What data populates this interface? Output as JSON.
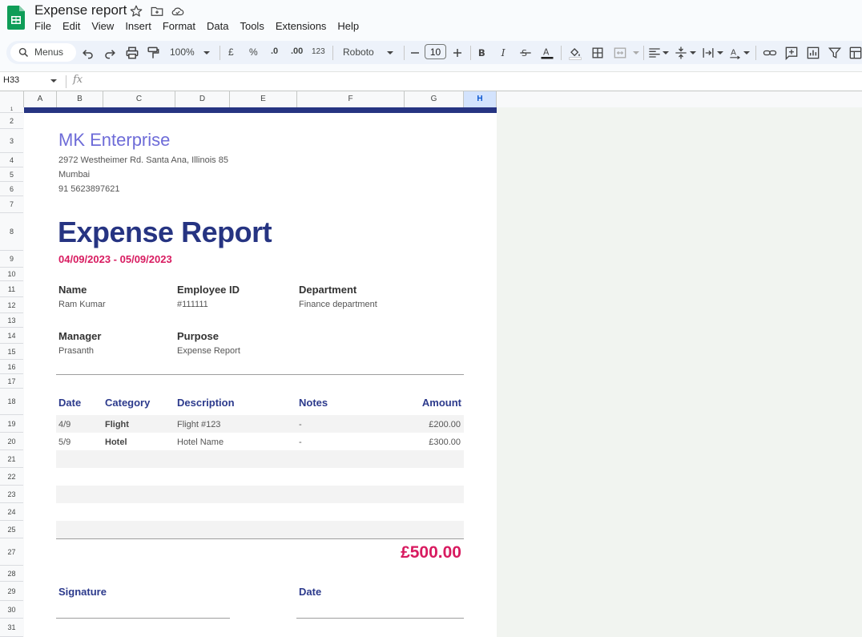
{
  "app": {
    "title": "Expense report",
    "menu": [
      "File",
      "Edit",
      "View",
      "Insert",
      "Format",
      "Data",
      "Tools",
      "Extensions",
      "Help"
    ]
  },
  "toolbar": {
    "search_label": "Menus",
    "zoom": "100%",
    "currency": "£",
    "percent": "%",
    "decrease_decimal": ".0",
    "increase_decimal": ".00",
    "number_format": "123",
    "font": "Roboto",
    "font_size": "10"
  },
  "formula_bar": {
    "cell_ref": "H33",
    "fx": "fx"
  },
  "columns": [
    "A",
    "B",
    "C",
    "D",
    "E",
    "F",
    "G",
    "H"
  ],
  "rows": [
    "1",
    "2",
    "3",
    "4",
    "5",
    "6",
    "7",
    "8",
    "9",
    "10",
    "11",
    "12",
    "13",
    "14",
    "15",
    "16",
    "17",
    "18",
    "19",
    "20",
    "21",
    "22",
    "23",
    "24",
    "25",
    "27",
    "28",
    "29",
    "30",
    "31"
  ],
  "colors": {
    "accent_blue": "#2c3a8c",
    "accent_pink": "#d81b60",
    "company": "#6e6cd8",
    "band": "#263482"
  },
  "sheet": {
    "company": "MK Enterprise",
    "address": "2972 Westheimer Rd. Santa Ana, Illinois 85",
    "city": "Mumbai",
    "phone": "91 5623897621",
    "heading": "Expense Report",
    "date_range": "04/09/2023 - 05/09/2023",
    "fields": {
      "name_label": "Name",
      "name": "Ram Kumar",
      "employee_id_label": "Employee ID",
      "employee_id": "#111111",
      "department_label": "Department",
      "department": "Finance department",
      "manager_label": "Manager",
      "manager": "Prasanth",
      "purpose_label": "Purpose",
      "purpose": "Expense  Report"
    },
    "table": {
      "headers": [
        "Date",
        "Category",
        "Description",
        "Notes",
        "Amount"
      ],
      "rows": [
        [
          "4/9",
          "Flight",
          "Flight #123",
          "-",
          "£200.00"
        ],
        [
          "5/9",
          "Hotel",
          "Hotel Name",
          "-",
          "£300.00"
        ]
      ]
    },
    "total": "£500.00",
    "signature_label": "Signature",
    "date_label": "Date"
  }
}
